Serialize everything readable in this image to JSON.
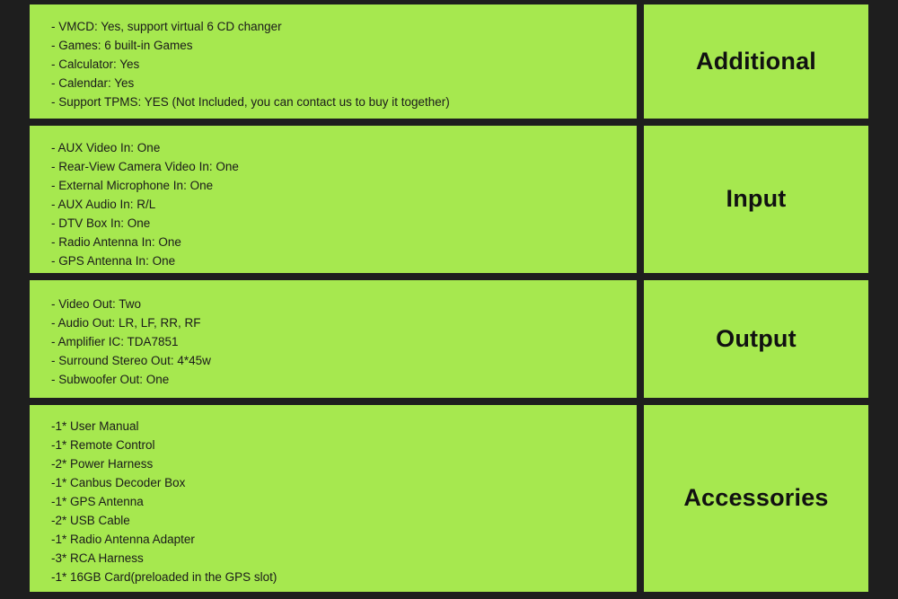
{
  "colors": {
    "panel_green": "#a6e84f",
    "background_dark": "#1e1e1e",
    "text_dark": "#1a1a1a"
  },
  "sections": [
    {
      "label": "Additional",
      "lines": [
        "- VMCD: Yes, support virtual 6 CD changer",
        "- Games: 6 built-in Games",
        "- Calculator: Yes",
        "- Calendar: Yes",
        "- Support TPMS: YES (Not Included, you can contact us to buy it together)"
      ]
    },
    {
      "label": "Input",
      "lines": [
        "- AUX Video In: One",
        "- Rear-View Camera Video In: One",
        "- External Microphone In: One",
        "- AUX Audio In: R/L",
        "- DTV Box In: One",
        "- Radio Antenna In: One",
        "- GPS Antenna In: One"
      ]
    },
    {
      "label": "Output",
      "lines": [
        "- Video Out: Two",
        "- Audio Out: LR, LF, RR, RF",
        "- Amplifier IC: TDA7851",
        "- Surround Stereo Out: 4*45w",
        "- Subwoofer Out: One"
      ]
    },
    {
      "label": "Accessories",
      "lines": [
        "-1* User Manual",
        "-1* Remote Control",
        "-2* Power Harness",
        "-1* Canbus Decoder Box",
        "-1* GPS Antenna",
        "-2* USB Cable",
        "-1* Radio Antenna Adapter",
        "-3* RCA Harness",
        "-1* 16GB Card(preloaded in the GPS slot)"
      ]
    }
  ]
}
